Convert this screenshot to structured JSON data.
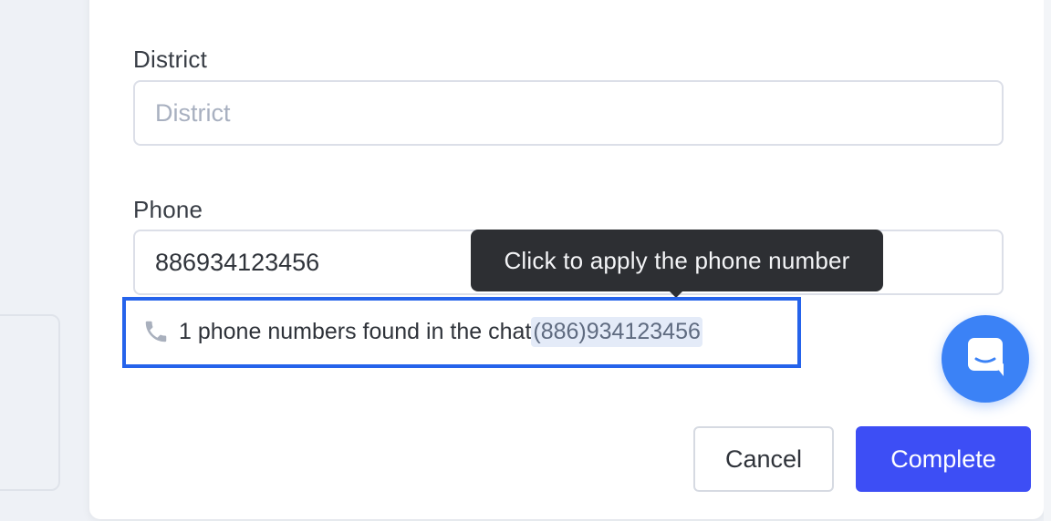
{
  "form": {
    "district": {
      "label": "District",
      "placeholder": "District",
      "value": ""
    },
    "phone": {
      "label": "Phone",
      "value": "886934123456"
    }
  },
  "phone_suggestion": {
    "prefix": "1 phone numbers found in the chat",
    "number": "(886)934123456",
    "tooltip": "Click to apply the phone number"
  },
  "actions": {
    "cancel_label": "Cancel",
    "complete_label": "Complete"
  },
  "colors": {
    "accent": "#3d4ef5",
    "highlight_border": "#2563eb",
    "chat_button": "#3b82f6",
    "tooltip_bg": "#2d2f33"
  },
  "icons": {
    "phone": "phone-icon",
    "chat": "chat-widget-icon"
  }
}
